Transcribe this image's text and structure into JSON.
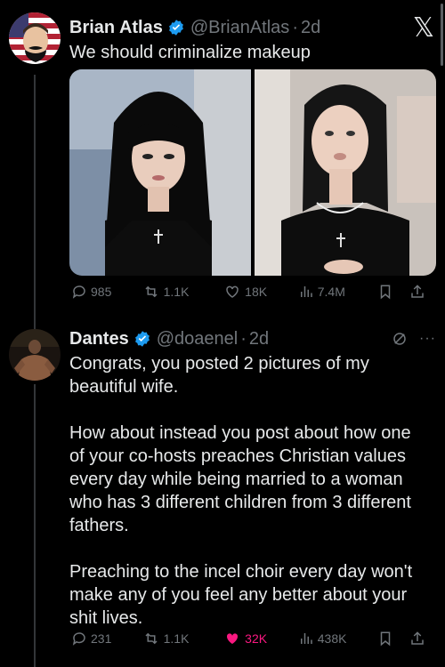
{
  "tweet1": {
    "name": "Brian Atlas",
    "handle": "@BrianAtlas",
    "separator": "·",
    "time": "2d",
    "text": "We should criminalize makeup",
    "stats": {
      "replies": "985",
      "reposts": "1.1K",
      "likes": "18K",
      "views": "7.4M"
    }
  },
  "tweet2": {
    "name": "Dantes",
    "handle": "@doaenel",
    "separator": "·",
    "time": "2d",
    "paragraphs": [
      "Congrats, you posted 2 pictures of my beautiful wife.",
      "How about instead you post about how one of your co-hosts preaches Christian values every day while being married to a woman who has 3 different children from 3 different fathers.",
      "Preaching to the incel choir every day won't make any of you feel any better about your shit lives."
    ],
    "stats": {
      "replies": "231",
      "reposts": "1.1K",
      "likes": "32K",
      "views": "438K"
    }
  },
  "colors": {
    "like_active": "#f91880",
    "verified": "#1d9bf0",
    "muted": "#71767b"
  },
  "icons": [
    "x-logo-icon",
    "verified-icon",
    "reply-icon",
    "repost-icon",
    "like-icon",
    "views-icon",
    "bookmark-icon",
    "share-icon",
    "grok-icon",
    "more-icon"
  ]
}
